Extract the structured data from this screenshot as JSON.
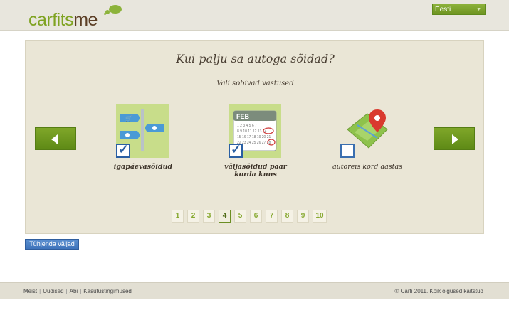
{
  "header": {
    "logo": {
      "part1": "carfits",
      "part2": "me"
    },
    "language": "Eesti"
  },
  "main": {
    "question": "Kui palju sa autoga sõidad?",
    "subtitle": "Vali sobivad vastused",
    "options": [
      {
        "label": "igapäevasõidud",
        "selected": true,
        "icon": "road-signs-icon"
      },
      {
        "label_line1": "väljasõidud paar",
        "label_line2": "korda kuus",
        "selected": true,
        "icon": "calendar-icon",
        "calendar_month": "FEB"
      },
      {
        "label": "autoreis kord aastas",
        "selected": false,
        "icon": "map-pin-icon"
      }
    ],
    "pages": [
      "1",
      "2",
      "3",
      "4",
      "5",
      "6",
      "7",
      "8",
      "9",
      "10"
    ],
    "active_page": "4",
    "clear_label": "Tühjenda väljad"
  },
  "footer": {
    "links": [
      "Meist",
      "Uudised",
      "Abi",
      "Kasutustingimused"
    ],
    "copyright": "© Carfi 2011. Kõik õigused kaitstud"
  },
  "colors": {
    "brand_green": "#7fa321",
    "brand_brown": "#5c3f26",
    "button_blue": "#3f74bb"
  }
}
